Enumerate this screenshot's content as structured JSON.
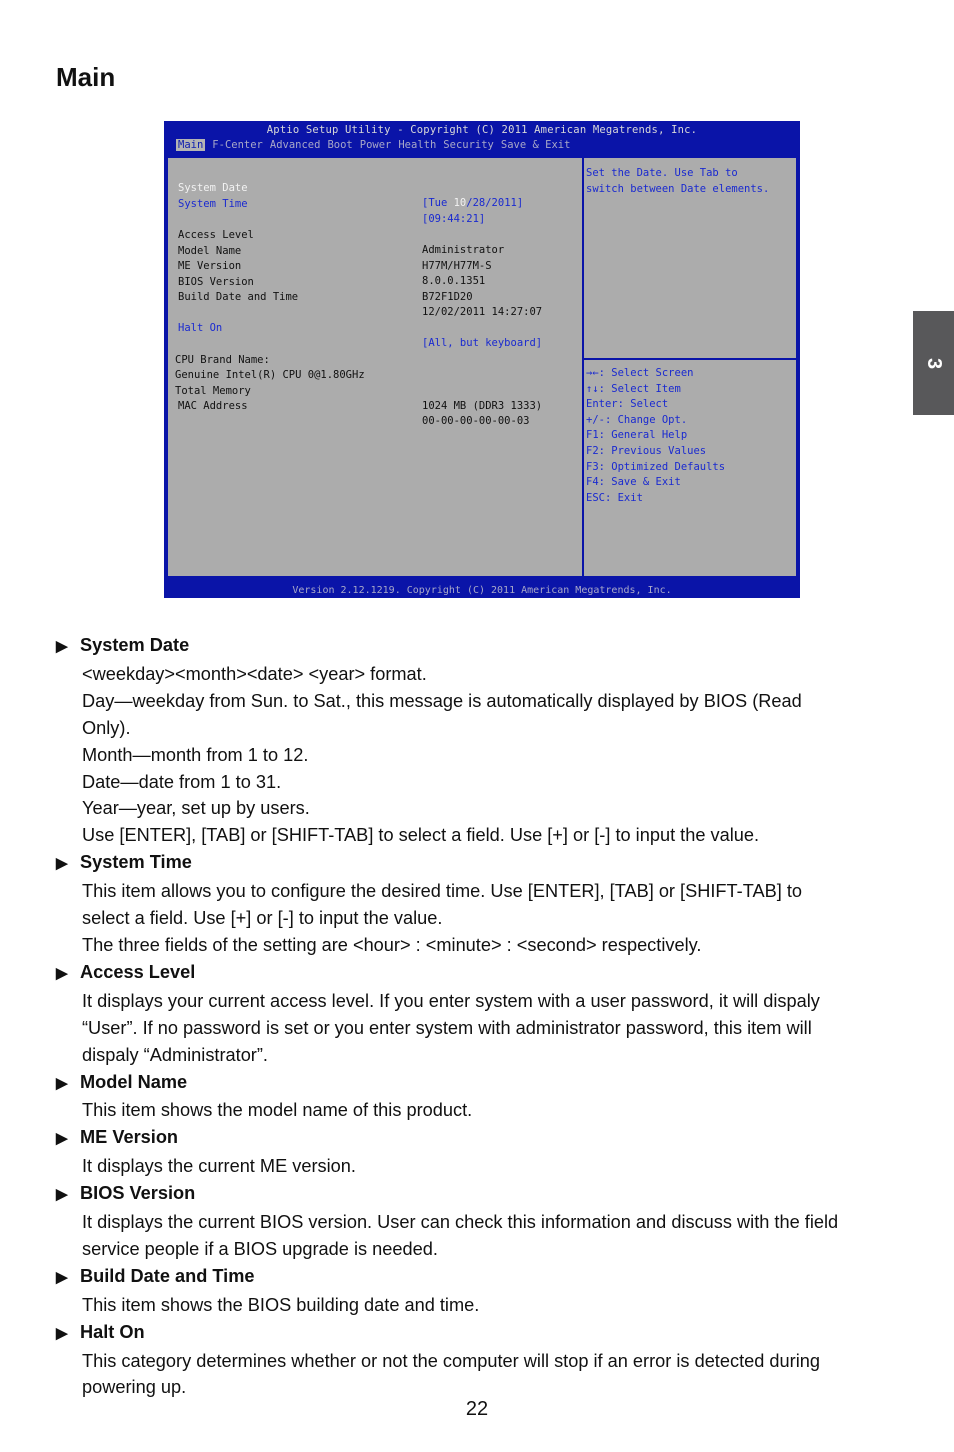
{
  "page": {
    "title": "Main",
    "chapter_tab": "3",
    "page_number": "22"
  },
  "bios": {
    "title": "Aptio Setup Utility - Copyright (C) 2011 American Megatrends, Inc.",
    "tabs": [
      {
        "label": "Main",
        "active": true
      },
      {
        "label": "F-Center"
      },
      {
        "label": "Advanced"
      },
      {
        "label": "Boot"
      },
      {
        "label": "Power"
      },
      {
        "label": "Health"
      },
      {
        "label": "Security"
      },
      {
        "label": "Save & Exit"
      }
    ],
    "items": {
      "system_date": {
        "label": "System Date",
        "value_prefix": "[Tue ",
        "value_highlight": "10",
        "value_suffix": "/28/2011]"
      },
      "system_time": {
        "label": "System Time",
        "value": "[09:44:21]"
      },
      "access_level": {
        "label": "Access Level",
        "value": "Administrator"
      },
      "model_name": {
        "label": "Model Name",
        "value": "H77M/H77M-S"
      },
      "me_version": {
        "label": "ME Version",
        "value": "8.0.0.1351"
      },
      "bios_version": {
        "label": "BIOS Version",
        "value": "B72F1D20"
      },
      "build_date": {
        "label": "Build Date and Time",
        "value": "12/02/2011 14:27:07"
      },
      "halt_on": {
        "label": "Halt On",
        "value": "[All, but keyboard]"
      },
      "cpu_brand_label": "CPU Brand Name:",
      "cpu_brand_value": "Genuine Intel(R) CPU 0@1.80GHz",
      "total_memory": {
        "label": "Total Memory",
        "value": "1024 MB (DDR3 1333)"
      },
      "mac_address": {
        "label": "MAC Address",
        "value": "00-00-00-00-00-03"
      }
    },
    "help_text": [
      "Set the Date. Use Tab to",
      "switch between Date elements."
    ],
    "key_help": [
      "→←: Select Screen",
      "↑↓: Select Item",
      "Enter: Select",
      "+/-: Change Opt.",
      "F1: General Help",
      "F2: Previous Values",
      "F3: Optimized Defaults",
      "F4: Save & Exit",
      "ESC: Exit"
    ],
    "footer": "Version 2.12.1219. Copyright (C) 2011 American Megatrends, Inc.",
    "colors": {
      "frame": "#0a14a8",
      "panel": "#acacac",
      "selectable": "#1a2ad0"
    }
  },
  "sections": [
    {
      "heading": "System Date",
      "lines": [
        "<weekday><month><date> <year> format.",
        "Day—weekday from Sun. to Sat., this message is automatically displayed by BIOS (Read",
        "Only).",
        "Month—month from 1 to 12.",
        "Date—date from 1 to 31.",
        "Year—year, set up by users.",
        "Use [ENTER], [TAB] or [SHIFT-TAB] to select a field. Use [+] or [-] to input the value."
      ]
    },
    {
      "heading": "System Time",
      "lines": [
        "This item allows you to configure the desired time. Use [ENTER], [TAB] or [SHIFT-TAB] to",
        "select a field. Use [+] or [-] to input the value.",
        "The three fields of the setting are <hour> : <minute> : <second> respectively."
      ]
    },
    {
      "heading": "Access Level",
      "lines": [
        "It displays your current access level. If you enter system with a user password, it will dispaly",
        "“User”. If no password is set or you enter system with administrator password, this item will",
        "dispaly “Administrator”."
      ]
    },
    {
      "heading": "Model Name",
      "lines": [
        "This item shows the model name of this product."
      ]
    },
    {
      "heading": "ME Version",
      "lines": [
        "It displays the current ME version."
      ]
    },
    {
      "heading": "BIOS Version",
      "lines": [
        "It displays the current BIOS version. User can check this information and discuss with the field",
        "service people if a BIOS upgrade is needed."
      ]
    },
    {
      "heading": "Build Date and Time",
      "lines": [
        "This item shows the BIOS building date and time."
      ]
    },
    {
      "heading": "Halt On",
      "lines": [
        "This category determines whether or not the computer will stop if an error is detected during",
        "powering up."
      ]
    }
  ],
  "icons": {
    "bullet": "▶"
  }
}
